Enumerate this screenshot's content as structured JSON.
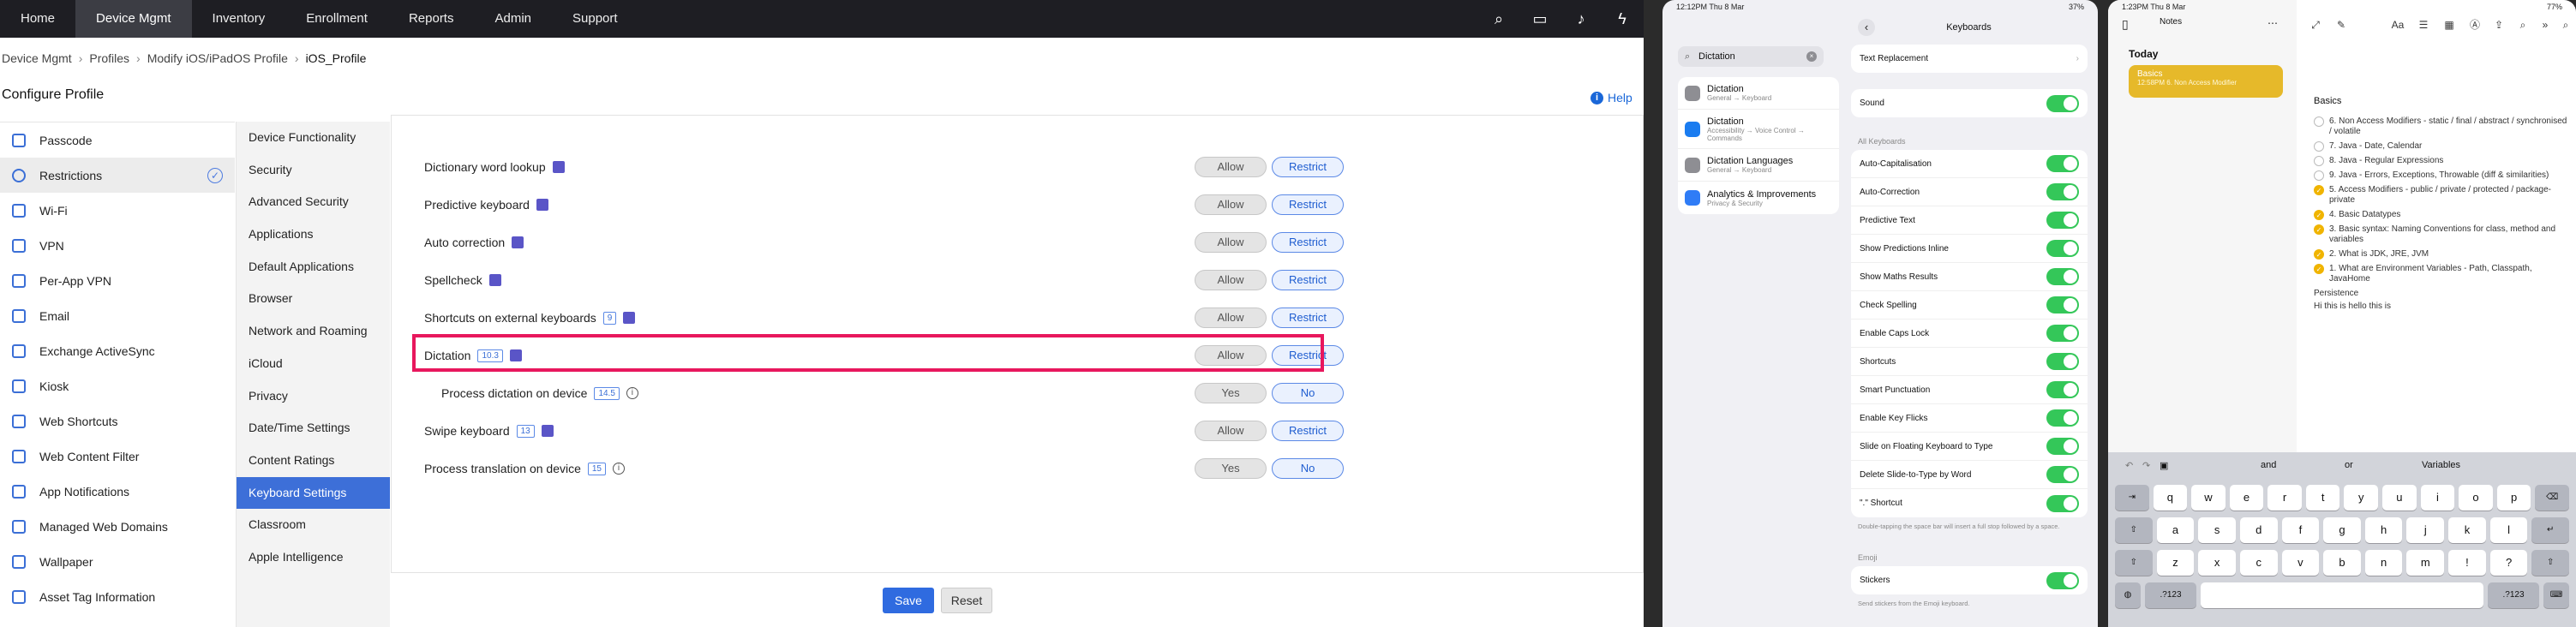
{
  "mdm": {
    "nav": [
      "Home",
      "Device Mgmt",
      "Inventory",
      "Enrollment",
      "Reports",
      "Admin",
      "Support"
    ],
    "nav_active": "Device Mgmt",
    "breadcrumb": [
      "Device Mgmt",
      "Profiles",
      "Modify iOS/iPadOS Profile",
      "iOS_Profile"
    ],
    "page_title": "Configure Profile",
    "help": "Help",
    "left_nav": [
      "Passcode",
      "Restrictions",
      "Wi-Fi",
      "VPN",
      "Per-App VPN",
      "Email",
      "Exchange ActiveSync",
      "Kiosk",
      "Web Shortcuts",
      "Web Content Filter",
      "App Notifications",
      "Managed Web Domains",
      "Wallpaper",
      "Asset Tag Information"
    ],
    "left_nav_active": "Restrictions",
    "sub_nav": [
      "Device Functionality",
      "Security",
      "Advanced Security",
      "Applications",
      "Default Applications",
      "Browser",
      "Network and Roaming",
      "iCloud",
      "Privacy",
      "Date/Time Settings",
      "Content Ratings",
      "Keyboard Settings",
      "Classroom",
      "Apple Intelligence"
    ],
    "sub_nav_active": "Keyboard Settings",
    "settings": [
      {
        "label": "Dictionary word lookup",
        "ver": "",
        "opt1": "Allow",
        "opt2": "Restrict"
      },
      {
        "label": "Predictive keyboard",
        "ver": "",
        "opt1": "Allow",
        "opt2": "Restrict"
      },
      {
        "label": "Auto correction",
        "ver": "",
        "opt1": "Allow",
        "opt2": "Restrict"
      },
      {
        "label": "Spellcheck",
        "ver": "",
        "opt1": "Allow",
        "opt2": "Restrict"
      },
      {
        "label": "Shortcuts on external keyboards",
        "ver": "9",
        "opt1": "Allow",
        "opt2": "Restrict"
      },
      {
        "label": "Dictation",
        "ver": "10.3",
        "opt1": "Allow",
        "opt2": "Restrict"
      },
      {
        "label": "Process dictation on device",
        "ver": "14.5",
        "opt1": "Yes",
        "opt2": "No"
      },
      {
        "label": "Swipe keyboard",
        "ver": "13",
        "opt1": "Allow",
        "opt2": "Restrict"
      },
      {
        "label": "Process translation on device",
        "ver": "15",
        "opt1": "Yes",
        "opt2": "No"
      }
    ],
    "save": "Save",
    "reset": "Reset"
  },
  "ipad_settings": {
    "time": "12:12PM  Thu 8 Mar",
    "battery": "37%",
    "search": "Dictation",
    "results": [
      {
        "title": "Dictation",
        "sub": "General → Keyboard"
      },
      {
        "title": "Dictation",
        "sub": "Accessibility → Voice Control → Commands"
      },
      {
        "title": "Dictation Languages",
        "sub": "General → Keyboard"
      },
      {
        "title": "Analytics & Improvements",
        "sub": "Privacy & Security"
      }
    ],
    "header": "Keyboards",
    "text_replacement": "Text Replacement",
    "sound": "Sound",
    "all_keyboards": "All Keyboards",
    "toggles": [
      "Auto-Capitalisation",
      "Auto-Correction",
      "Predictive Text",
      "Show Predictions Inline",
      "Show Maths Results",
      "Check Spelling",
      "Enable Caps Lock",
      "Shortcuts",
      "Smart Punctuation",
      "Enable Key Flicks",
      "Slide on Floating Keyboard to Type",
      "Delete Slide-to-Type by Word",
      "\".\" Shortcut"
    ],
    "shortcut_note": "Double-tapping the space bar will insert a full stop followed by a space.",
    "emoji_header": "Emoji",
    "stickers": "Stickers",
    "stickers_note": "Send stickers from the Emoji keyboard."
  },
  "ipad_notes": {
    "time": "1:23PM  Thu 8 Mar",
    "battery": "77%",
    "title": "Notes",
    "today": "Today",
    "note_title": "Basics",
    "note_preview": "12:58PM  6. Non Access Modifier",
    "heading": "Basics",
    "items": [
      {
        "text": "6. Non Access Modifiers - static / final / abstract / synchronised / volatile",
        "done": false
      },
      {
        "text": "7. Java - Date, Calendar",
        "done": false
      },
      {
        "text": "8. Java - Regular Expressions",
        "done": false
      },
      {
        "text": "9. Java - Errors, Exceptions, Throwable (diff & similarities)",
        "done": false
      },
      {
        "text": "5. Access Modifiers - public / private / protected / package-private",
        "done": true
      },
      {
        "text": "4. Basic Datatypes",
        "done": true
      },
      {
        "text": "3. Basic syntax: Naming Conventions for class, method and variables",
        "done": true
      },
      {
        "text": "2. What is JDK, JRE, JVM",
        "done": true
      },
      {
        "text": "1. What are Environment Variables - Path, Classpath, JavaHome",
        "done": true
      }
    ],
    "line1": "Persistence",
    "line2": "Hi this is hello this is",
    "suggestions": [
      "and",
      "or",
      "Variables"
    ],
    "row1": [
      "q",
      "w",
      "e",
      "r",
      "t",
      "y",
      "u",
      "i",
      "o",
      "p"
    ],
    "row2": [
      "a",
      "s",
      "d",
      "f",
      "g",
      "h",
      "j",
      "k",
      "l"
    ],
    "row3": [
      "z",
      "x",
      "c",
      "v",
      "b",
      "n",
      "m",
      "!",
      "?"
    ],
    "row4": [
      ".?123",
      ".?123"
    ]
  }
}
